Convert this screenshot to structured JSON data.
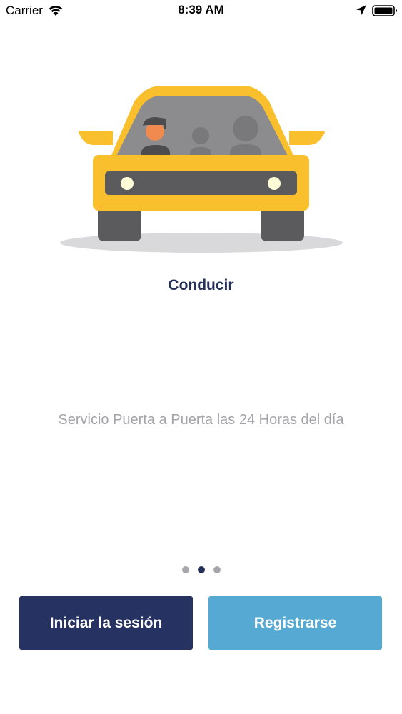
{
  "status_bar": {
    "carrier": "Carrier",
    "time": "8:39 AM",
    "icons": [
      "wifi-icon",
      "location-arrow-icon",
      "battery-icon"
    ]
  },
  "onboarding": {
    "illustration": "car-with-driver-illustration",
    "title": "Conducir",
    "description": "Servicio Puerta a Puerta las 24 Horas del día",
    "pages": {
      "total": 3,
      "current": 2
    }
  },
  "actions": {
    "login_label": "Iniciar la sesión",
    "register_label": "Registrarse"
  },
  "colors": {
    "primary_navy": "#253262",
    "accent_blue": "#56a9d2",
    "car_yellow": "#f9bf2c",
    "text_gray": "#a3a3a8"
  }
}
